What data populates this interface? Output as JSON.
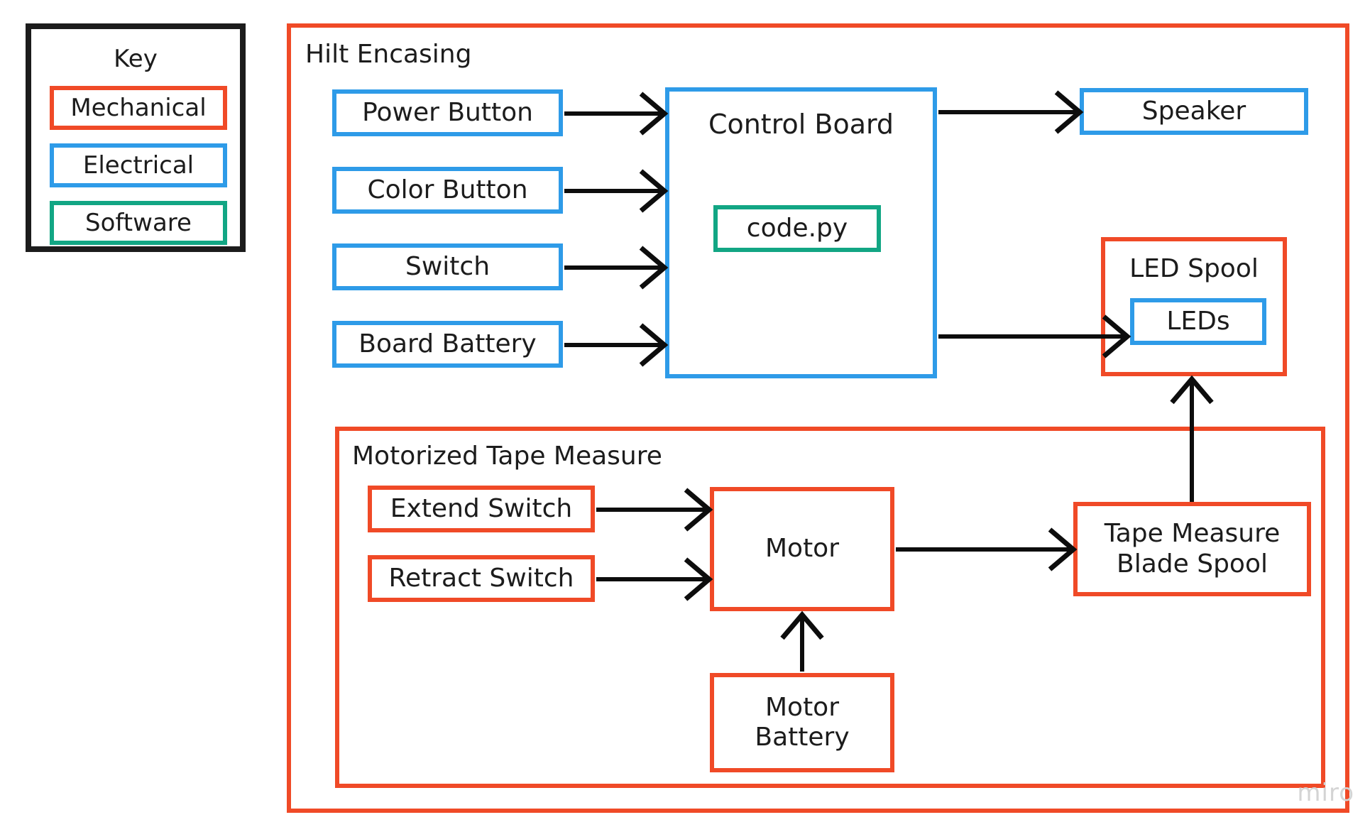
{
  "palette": {
    "mechanical": "#F04A27",
    "electrical": "#2E9BE8",
    "software": "#12A684",
    "key_border": "#1c1c1c",
    "wire": "#0d0d0d",
    "background": "#ffffff",
    "watermark": "#d4d4d4"
  },
  "key": {
    "title": "Key",
    "items": [
      {
        "label": "Mechanical",
        "category": "mechanical"
      },
      {
        "label": "Electrical",
        "category": "electrical"
      },
      {
        "label": "Software",
        "category": "software"
      }
    ]
  },
  "diagram": {
    "hilt": {
      "title": "Hilt Encasing",
      "category": "mechanical"
    },
    "tape_measure": {
      "title": "Motorized Tape Measure",
      "category": "mechanical"
    },
    "nodes": {
      "power_button": {
        "label": "Power Button",
        "category": "electrical"
      },
      "color_button": {
        "label": "Color Button",
        "category": "electrical"
      },
      "switch": {
        "label": "Switch",
        "category": "electrical"
      },
      "board_battery": {
        "label": "Board Battery",
        "category": "electrical"
      },
      "control_board": {
        "label": "Control Board",
        "category": "electrical"
      },
      "code_py": {
        "label": "code.py",
        "category": "software"
      },
      "speaker": {
        "label": "Speaker",
        "category": "electrical"
      },
      "led_spool": {
        "label": "LED Spool",
        "category": "mechanical"
      },
      "leds": {
        "label": "LEDs",
        "category": "electrical"
      },
      "extend_switch": {
        "label": "Extend Switch",
        "category": "mechanical"
      },
      "retract_switch": {
        "label": "Retract Switch",
        "category": "mechanical"
      },
      "motor": {
        "label": "Motor",
        "category": "mechanical"
      },
      "motor_battery_line1": {
        "label": "Motor",
        "category": "mechanical"
      },
      "motor_battery_line2": {
        "label": "Battery",
        "category": "mechanical"
      },
      "blade_spool_line1": {
        "label": "Tape Measure",
        "category": "mechanical"
      },
      "blade_spool_line2": {
        "label": "Blade Spool",
        "category": "mechanical"
      }
    },
    "connections": [
      {
        "from": "power_button",
        "to": "control_board"
      },
      {
        "from": "color_button",
        "to": "control_board"
      },
      {
        "from": "switch",
        "to": "control_board"
      },
      {
        "from": "board_battery",
        "to": "control_board"
      },
      {
        "from": "control_board",
        "to": "speaker"
      },
      {
        "from": "control_board",
        "to": "leds"
      },
      {
        "from": "extend_switch",
        "to": "motor"
      },
      {
        "from": "retract_switch",
        "to": "motor"
      },
      {
        "from": "motor",
        "to": "blade_spool"
      },
      {
        "from": "motor_battery",
        "to": "motor"
      },
      {
        "from": "blade_spool",
        "to": "led_spool"
      }
    ]
  },
  "watermark": {
    "label": "miro"
  }
}
